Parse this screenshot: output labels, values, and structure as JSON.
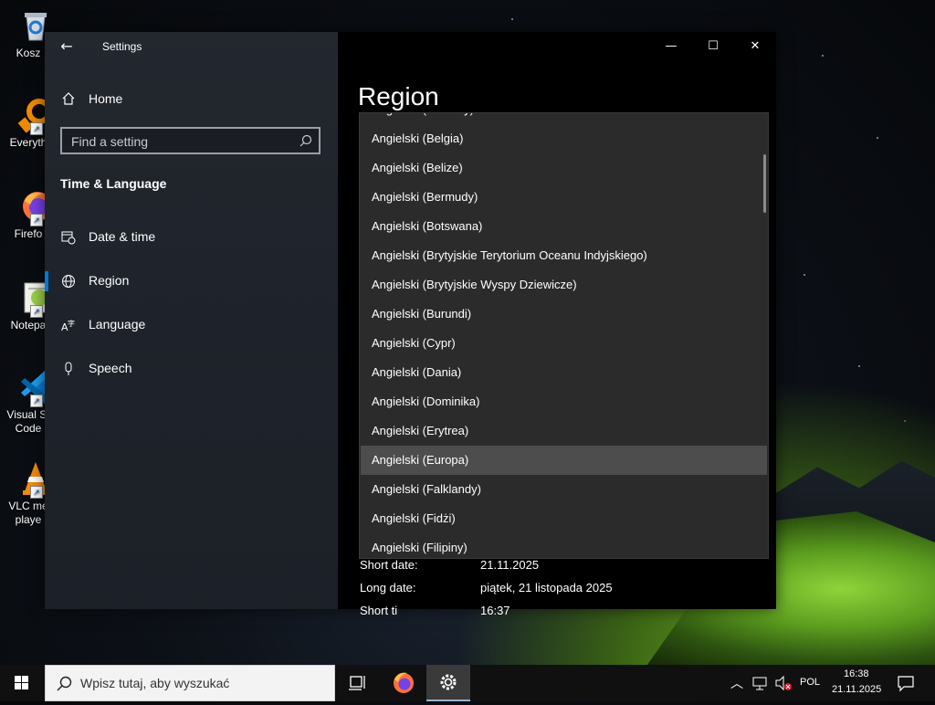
{
  "desktop": {
    "icons": [
      {
        "label": "Kosz",
        "icon": "recycle-bin-icon"
      },
      {
        "label": "Everyth",
        "icon": "everything-search-icon"
      },
      {
        "label": "Firefo",
        "icon": "firefox-icon"
      },
      {
        "label": "Notepa",
        "icon": "notepad-plus-plus-icon"
      },
      {
        "label": "Visual St",
        "label2": "Code",
        "icon": "vscode-icon"
      },
      {
        "label": "VLC me",
        "label2": "playe",
        "icon": "vlc-icon"
      }
    ]
  },
  "window": {
    "app_title": "Settings",
    "home_label": "Home",
    "search_placeholder": "Find a setting",
    "section_title": "Time & Language",
    "nav": [
      {
        "label": "Date & time",
        "icon": "calendar-clock-icon"
      },
      {
        "label": "Region",
        "icon": "globe-icon",
        "active": true
      },
      {
        "label": "Language",
        "icon": "language-icon"
      },
      {
        "label": "Speech",
        "icon": "microphone-icon"
      }
    ],
    "page_title": "Region",
    "formats": [
      {
        "label": "Short date:",
        "value": "21.11.2025"
      },
      {
        "label": "Long date:",
        "value": "piątek, 21 listopada 2025"
      },
      {
        "label": "Short ti",
        "value": "16:37"
      }
    ],
    "dropdown": {
      "partial_item": "Angielski (Bahamy)",
      "items": [
        "Angielski (Belgia)",
        "Angielski (Belize)",
        "Angielski (Bermudy)",
        "Angielski (Botswana)",
        "Angielski (Brytyjskie Terytorium Oceanu Indyjskiego)",
        "Angielski (Brytyjskie Wyspy Dziewicze)",
        "Angielski (Burundi)",
        "Angielski (Cypr)",
        "Angielski (Dania)",
        "Angielski (Dominika)",
        "Angielski (Erytrea)",
        "Angielski (Europa)",
        "Angielski (Falklandy)",
        "Angielski (Fidżi)",
        "Angielski (Filipiny)"
      ],
      "selected": "Angielski (Europa)"
    }
  },
  "taskbar": {
    "search_placeholder": "Wpisz tutaj, aby wyszukać",
    "language": "POL",
    "time": "16:38",
    "date": "21.11.2025"
  },
  "colors": {
    "accent": "#0078d7",
    "dropdown_bg": "#2b2b2b",
    "selected_bg": "#4d4d4d"
  }
}
